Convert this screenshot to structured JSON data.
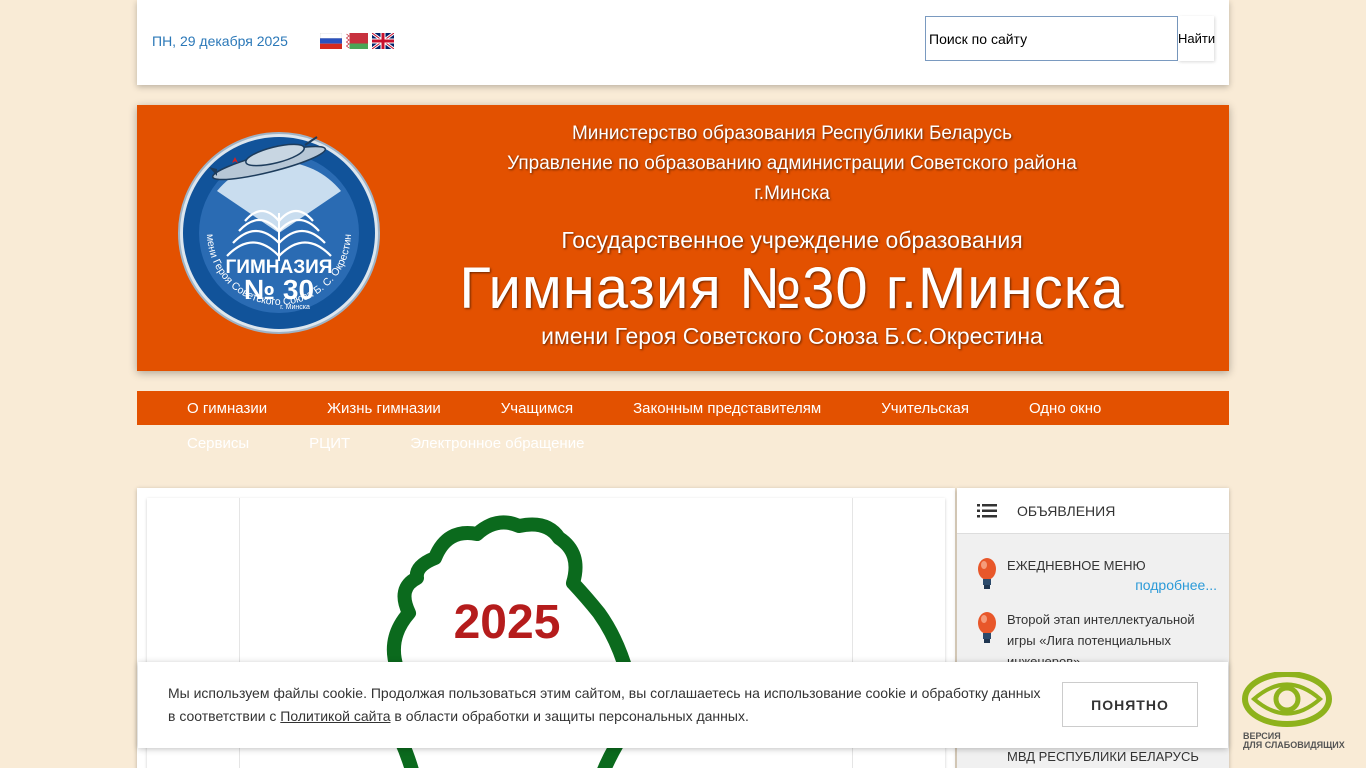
{
  "topbar": {
    "date": "ПН, 29 декабря 2025",
    "languages": [
      "ru-flag",
      "by-flag",
      "en-flag"
    ],
    "search_placeholder": "Поиск по сайту",
    "search_button": "Найти"
  },
  "header": {
    "line1": "Министерство образования Республики Беларусь",
    "line2": "Управление по образованию администрации Советского района",
    "line3": "г.Минска",
    "line4": "Государственное учреждение образования",
    "line5": "Гимназия №30 г.Минска",
    "line6": "имени Героя Советского Союза Б.С.Окрестина",
    "emblem": {
      "top": "ГИМНАЗИЯ",
      "number": "№ 30",
      "city": "г. Минска",
      "ring": "имени Героя Советского Союза Б. С. Окрестина"
    }
  },
  "menu": {
    "row1": [
      "О гимназии",
      "Жизнь гимназии",
      "Учащимся",
      "Законным представителям",
      "Учительская",
      "Одно окно"
    ],
    "row2": [
      "Сервисы",
      "РЦИТ",
      "Электронное обращение"
    ]
  },
  "main": {
    "banner_year": "2025"
  },
  "sidebar": {
    "title": "ОБЪЯВЛЕНИЯ",
    "items": [
      {
        "text": "ЕЖЕДНЕВНОЕ МЕНЮ",
        "more": "подробнее..."
      },
      {
        "text": "Второй этап интеллектуальной игры «Лига потенциальных инженеров»"
      },
      {
        "text": "МВД РЕСПУБЛИКИ БЕЛАРУСЬ"
      }
    ]
  },
  "cookie": {
    "text_before": "Мы используем файлы cookie. Продолжая пользоваться этим сайтом, вы соглашаетесь на использование cookie и обработку данных в соответствии с ",
    "link": "Политикой сайта",
    "text_after": " в области обработки и защиты персональных данных.",
    "button": "ПОНЯТНО"
  },
  "accessibility": {
    "line1": "ВЕРСИЯ",
    "line2": "ДЛЯ СЛАБОВИДЯЩИХ"
  },
  "colors": {
    "accent": "#e35100",
    "background": "#f9ebd6",
    "link": "#2b78b8"
  }
}
